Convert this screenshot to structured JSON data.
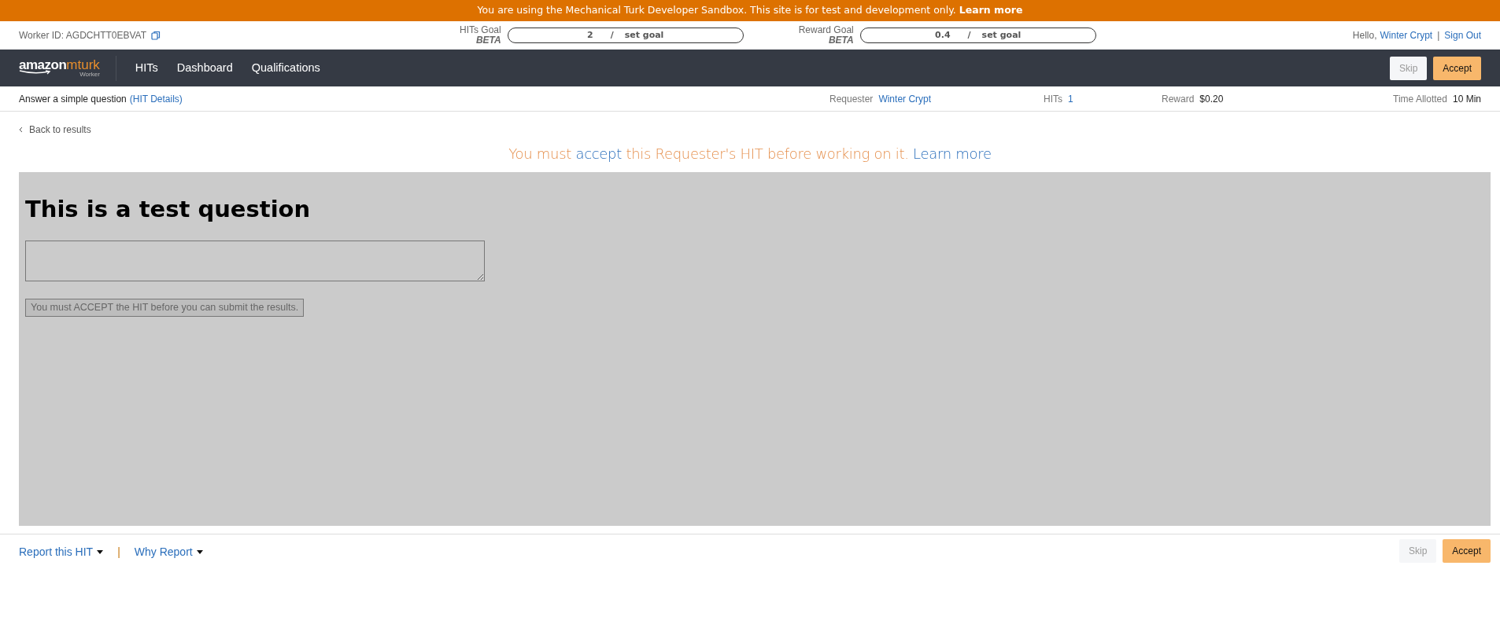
{
  "banner": {
    "text": "You are using the Mechanical Turk Developer Sandbox. This site is for test and development only.",
    "link": "Learn more"
  },
  "worker_bar": {
    "worker_id": "Worker ID: AGDCHTT0EBVAT",
    "goals": [
      {
        "label": "HITs Goal",
        "beta": "BETA",
        "value": "2",
        "separator": "/",
        "action": "set goal"
      },
      {
        "label": "Reward Goal",
        "beta": "BETA",
        "value": "0.4",
        "separator": "/",
        "action": "set goal"
      }
    ],
    "greeting": "Hello,",
    "user": "Winter Crypt",
    "divider": "|",
    "sign_out": "Sign Out"
  },
  "navbar": {
    "logo": {
      "brand": "amazon",
      "product": "mturk",
      "sub": "Worker"
    },
    "links": [
      "HITs",
      "Dashboard",
      "Qualifications"
    ],
    "buttons": [
      {
        "label": "Skip",
        "kind": "secondary"
      },
      {
        "label": "Accept",
        "kind": "primary"
      }
    ]
  },
  "hit_bar": {
    "title": "Answer a simple question",
    "details": "(HIT Details)",
    "fields": [
      {
        "label": "Requester",
        "value": "Winter Crypt",
        "kind": "link"
      },
      {
        "label": "HITs",
        "value": "1",
        "kind": "link"
      },
      {
        "label": "Reward",
        "value": "$0.20",
        "kind": "text"
      },
      {
        "label": "Time Allotted",
        "value": "10 Min",
        "kind": "text"
      }
    ]
  },
  "back_link": "Back to results",
  "notice": [
    {
      "text": "You must ",
      "kind": "text"
    },
    {
      "text": "accept",
      "kind": "link"
    },
    {
      "text": " this Requester's HIT before working on it. ",
      "kind": "text"
    },
    {
      "text": "Learn more",
      "kind": "link"
    }
  ],
  "task": {
    "heading": "This is a test question",
    "submit": "You must ACCEPT the HIT before you can submit the results."
  },
  "footer": {
    "links": [
      "Report this HIT",
      "Why Report"
    ],
    "separator": "|",
    "buttons": [
      {
        "label": "Skip",
        "kind": "secondary"
      },
      {
        "label": "Accept",
        "kind": "primary"
      }
    ]
  }
}
